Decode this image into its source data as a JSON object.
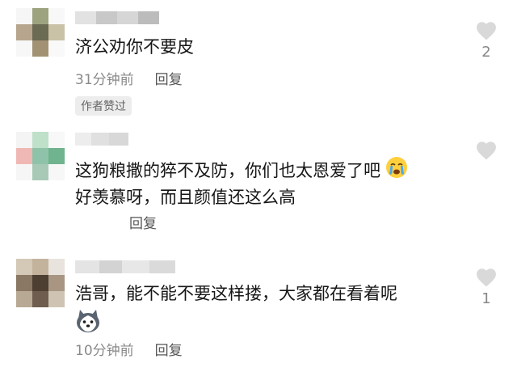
{
  "comments": [
    {
      "text_lines": [
        "济公劝你不要皮"
      ],
      "time": "31分钟前",
      "reply_label": "回复",
      "badge": "作者赞过",
      "like_count": "2"
    },
    {
      "text_lines": [
        "这狗粮撒的猝不及防，你们也太恩爱了吧",
        "好羡慕呀，而且颜值还这么高"
      ],
      "emoji": "crying-face",
      "reply_label": "回复"
    },
    {
      "text_lines": [
        "浩哥，能不能不要这样搂，大家都在看着呢"
      ],
      "emoji": "husky-dog-face",
      "time": "10分钟前",
      "reply_label": "回复",
      "like_count": "1"
    }
  ],
  "colors": {
    "text": "#161616",
    "meta": "#8a8a8a",
    "heart": "#d9d9d9",
    "badge_bg": "#ededed"
  }
}
